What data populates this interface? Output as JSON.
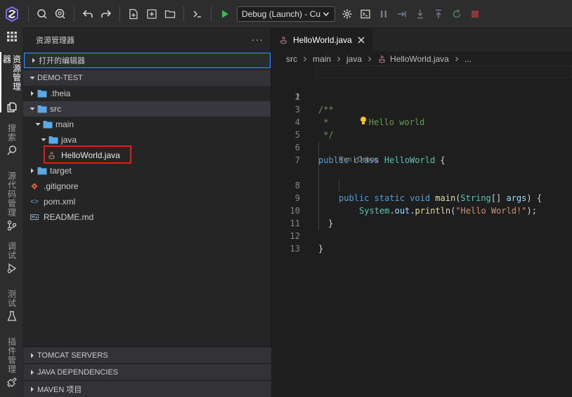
{
  "toolbar": {
    "debug_config": "Debug (Launch) - Cu"
  },
  "activity_bar": {
    "explorer": "资源管理器",
    "search": "搜索",
    "scm": "源代码管理",
    "debug": "调试",
    "test": "测试",
    "extensions": "插件管理"
  },
  "sidebar": {
    "title": "资源管理器",
    "more": "···",
    "open_editors": "打开的编辑器",
    "workspace": "DEMO-TEST",
    "tree": {
      "theia": ".theia",
      "src": "src",
      "main": "main",
      "java": "java",
      "helloworld": "HelloWorld.java",
      "target": "target",
      "gitignore": ".gitignore",
      "pom": "pom.xml",
      "readme": "README.md"
    },
    "bottom_sections": [
      "TOMCAT SERVERS",
      "JAVA DEPENDENCIES",
      "MAVEN 项目"
    ]
  },
  "editor": {
    "tab_label": "HelloWorld.java",
    "breadcrumb": [
      "src",
      "main",
      "java",
      "HelloWorld.java",
      "..."
    ],
    "code_lens": "Run | Debug",
    "line_numbers": [
      "1",
      "2",
      "3",
      "4",
      "5",
      "6",
      "7",
      "8",
      "9",
      "10",
      "11",
      "12",
      "13"
    ],
    "code": {
      "l1": "/**",
      "l2": "Hello world",
      "l3": " *",
      "l4": " */",
      "l6_kw": "public class ",
      "l6_cls": "HelloWorld",
      "l6_rest": " {",
      "l8_kw": "public static void ",
      "l8_fn": "main",
      "l8_p1": "(",
      "l8_cls": "String",
      "l8_p2": "[] ",
      "l8_var": "args",
      "l8_p3": ") {",
      "l9_cls": "System",
      "l9_dot1": ".",
      "l9_var": "out",
      "l9_dot2": ".",
      "l9_fn": "println",
      "l9_p1": "(",
      "l9_str": "\"Hello World!\"",
      "l9_p2": ");",
      "l10": "}",
      "l12": "}"
    }
  },
  "colors": {
    "accent_blue": "#3794ff",
    "highlight_red": "#e01b1b",
    "run_green": "#3fb950",
    "folder_blue": "#5aa9e6"
  }
}
